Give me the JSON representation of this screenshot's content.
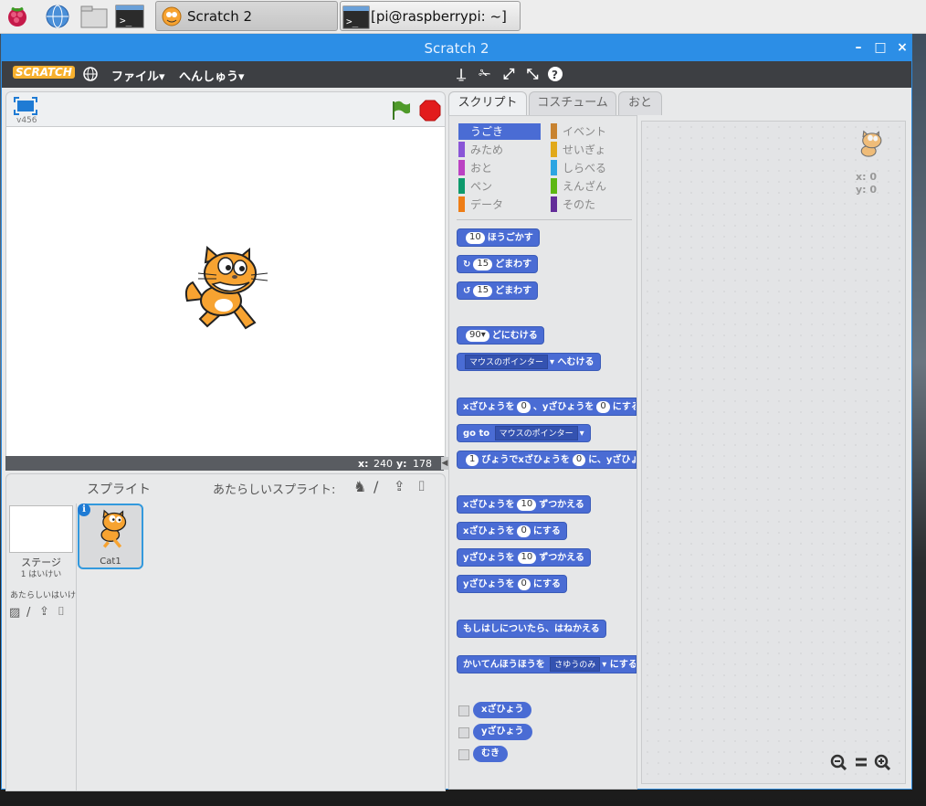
{
  "taskbar": {
    "apps": [
      {
        "label": "Scratch 2"
      },
      {
        "label": "[pi@raspberrypi: ~]"
      }
    ]
  },
  "window": {
    "title": "Scratch 2"
  },
  "menu": {
    "logo": "SCRATCH",
    "file": "ファイル▾",
    "edit": "へんしゅう▾"
  },
  "stage": {
    "version": "v456",
    "coord_x_label": "x:",
    "coord_x": "240",
    "coord_y_label": "y:",
    "coord_y": "178"
  },
  "sprites": {
    "header": "スプライト",
    "new_sprite": "あたらしいスプライト:",
    "stage_label": "ステージ",
    "stage_bg_count": "1 はいけい",
    "new_bg": "あたらしいはいけい",
    "items": [
      {
        "name": "Cat1"
      }
    ]
  },
  "tabs": [
    "スクリプト",
    "コスチューム",
    "おと"
  ],
  "categories": {
    "left": [
      {
        "label": "うごき",
        "color": "#4a6cd4",
        "selected": true
      },
      {
        "label": "みため",
        "color": "#8a55d7"
      },
      {
        "label": "おと",
        "color": "#bb42c3"
      },
      {
        "label": "ペン",
        "color": "#0e9a6c"
      },
      {
        "label": "データ",
        "color": "#ee7d16"
      }
    ],
    "right": [
      {
        "label": "イベント",
        "color": "#c88330"
      },
      {
        "label": "せいぎょ",
        "color": "#e1a91a"
      },
      {
        "label": "しらべる",
        "color": "#2ca5e2"
      },
      {
        "label": "えんざん",
        "color": "#5cb712"
      },
      {
        "label": "そのた",
        "color": "#632d99"
      }
    ]
  },
  "blocks": {
    "move": {
      "val": "10",
      "text": "ほうごかす"
    },
    "turn_right": {
      "val": "15",
      "text": "どまわす"
    },
    "turn_left": {
      "val": "15",
      "text": "どまわす"
    },
    "point_dir": {
      "val": "90▾",
      "text": "どにむける"
    },
    "point_towards": {
      "drop": "マウスのポインター",
      "text": "へむける"
    },
    "goto_xy": {
      "a": "xざひょうを",
      "v1": "0",
      "b": "、yざひょうを",
      "v2": "0",
      "c": "にする"
    },
    "goto": {
      "a": "go to",
      "drop": "マウスのポインター"
    },
    "glide": {
      "v1": "1",
      "a": "びょうでxざひょうを",
      "v2": "0",
      "b": "に、yざひょう"
    },
    "change_x": {
      "a": "xざひょうを",
      "v": "10",
      "b": "ずつかえる"
    },
    "set_x": {
      "a": "xざひょうを",
      "v": "0",
      "b": "にする"
    },
    "change_y": {
      "a": "yざひょうを",
      "v": "10",
      "b": "ずつかえる"
    },
    "set_y": {
      "a": "yざひょうを",
      "v": "0",
      "b": "にする"
    },
    "bounce": {
      "text": "もしはしについたら、はねかえる"
    },
    "rotation": {
      "a": "かいてんほうほうを",
      "drop": "さゆうのみ",
      "b": "にする"
    },
    "reporters": [
      "xざひょう",
      "yざひょう",
      "むき"
    ]
  },
  "sprite_info": {
    "x": "x: 0",
    "y": "y: 0"
  },
  "colors": {
    "titlebar": "#2c8ee6",
    "menubar": "#3d3f43",
    "motion": "#4a6cd4"
  }
}
